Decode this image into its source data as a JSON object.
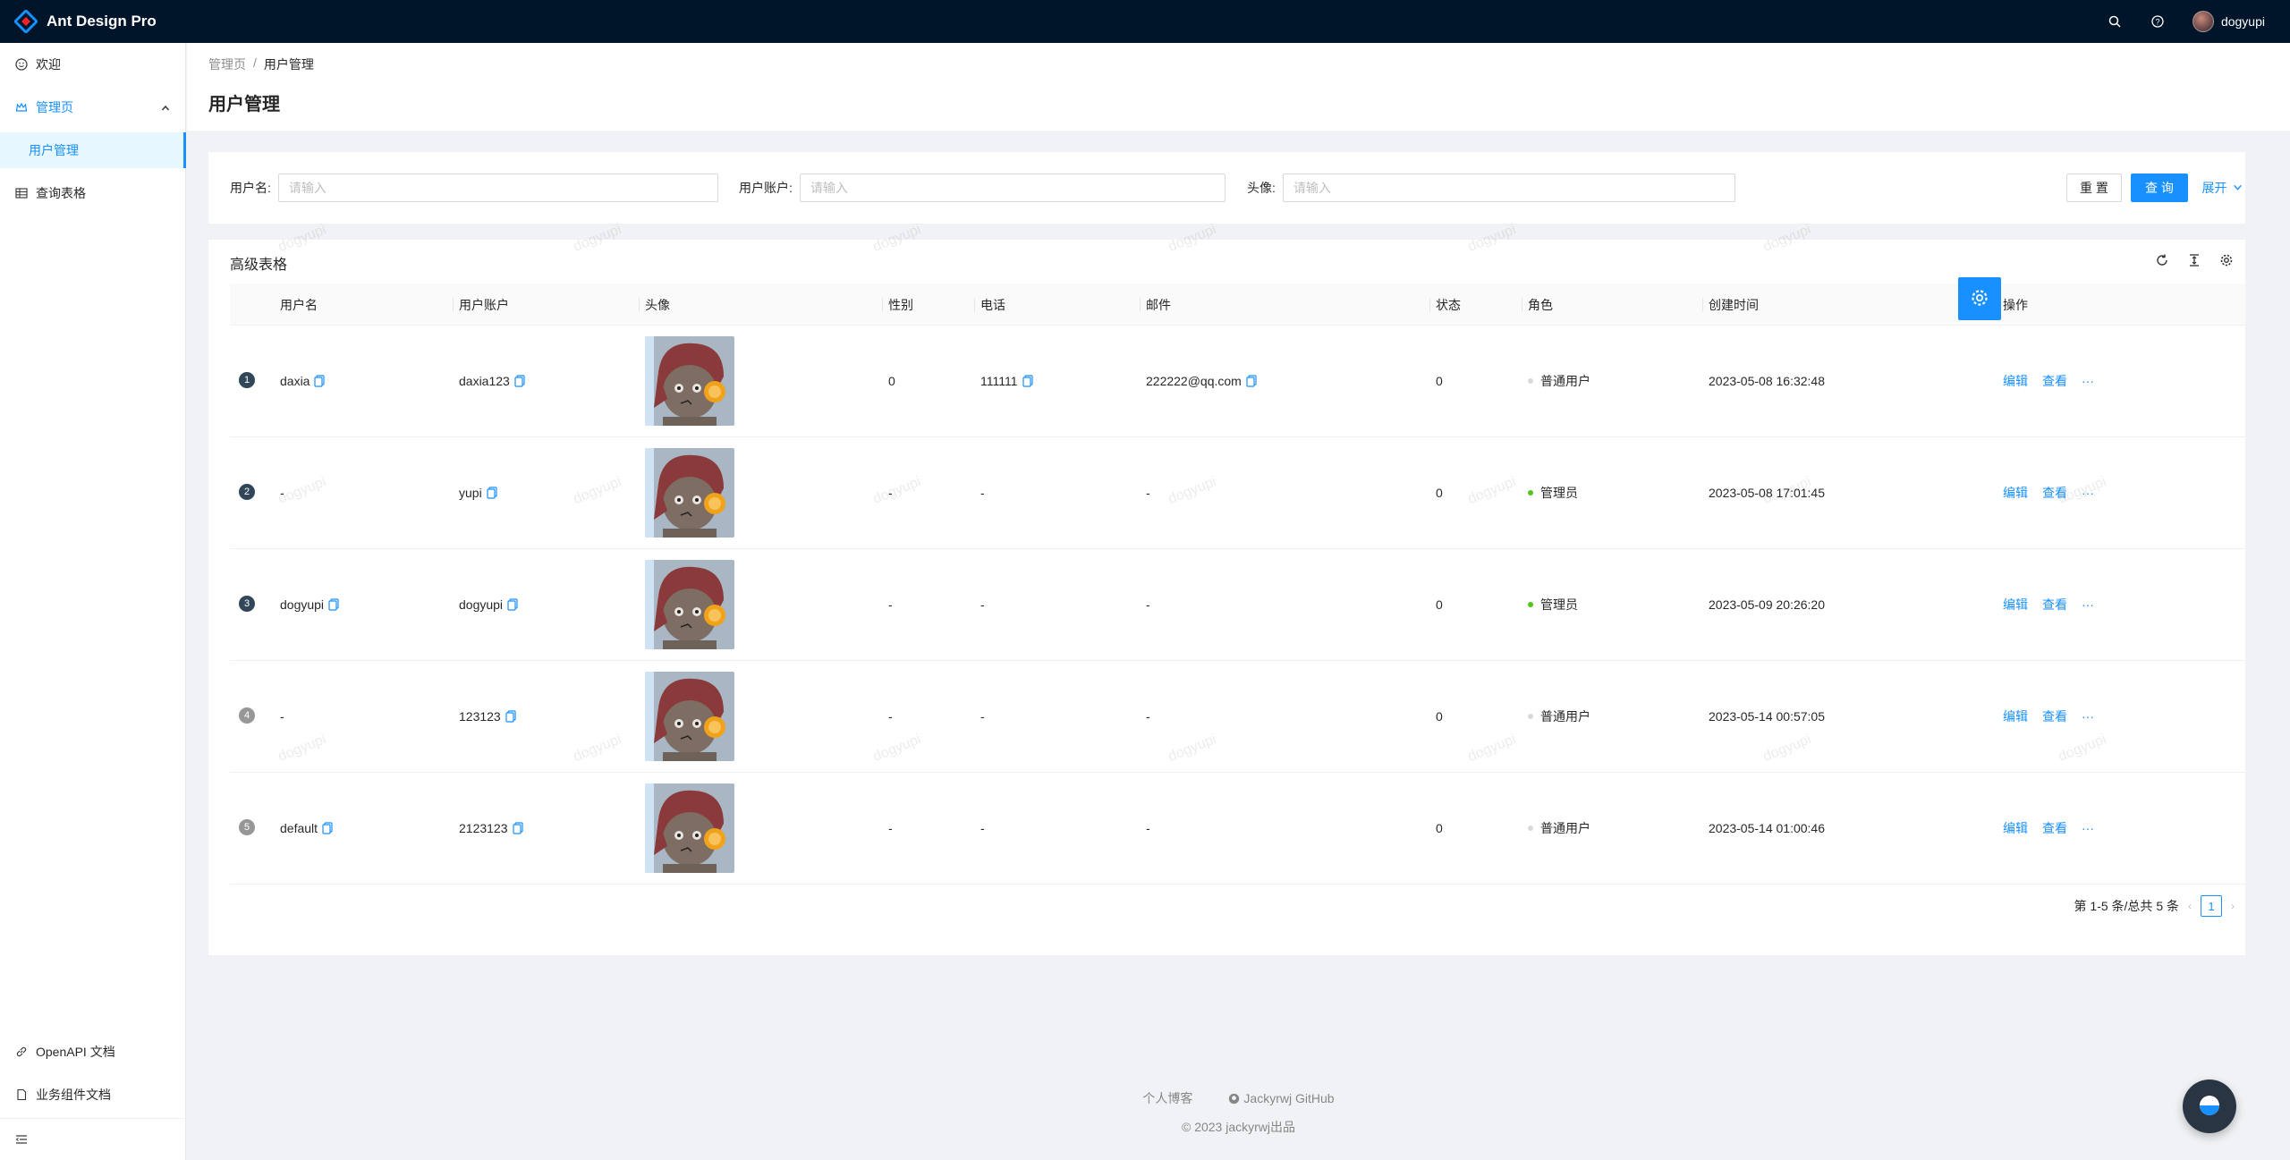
{
  "app": {
    "title": "Ant Design Pro"
  },
  "header": {
    "user_name": "dogyupi",
    "icons": [
      "search-icon",
      "question-icon"
    ]
  },
  "sidebar": {
    "items": [
      {
        "label": "欢迎",
        "icon": "smile-icon"
      },
      {
        "label": "管理页",
        "icon": "crown-icon"
      },
      {
        "label": "用户管理"
      },
      {
        "label": "查询表格",
        "icon": "table-icon"
      }
    ],
    "bottom": [
      {
        "label": "OpenAPI 文档",
        "icon": "link-icon"
      },
      {
        "label": "业务组件文档",
        "icon": "file-icon"
      }
    ]
  },
  "breadcrumb": [
    "管理页",
    "/",
    "用户管理"
  ],
  "page_title": "用户管理",
  "search": {
    "fields": [
      {
        "label": "用户名:",
        "placeholder": "请输入"
      },
      {
        "label": "用户账户:",
        "placeholder": "请输入"
      },
      {
        "label": "头像:",
        "placeholder": "请输入"
      }
    ],
    "reset_label": "重 置",
    "query_label": "查 询",
    "expand_label": "展开"
  },
  "table": {
    "title": "高级表格",
    "columns": [
      "用户名",
      "用户账户",
      "头像",
      "性别",
      "电话",
      "邮件",
      "状态",
      "角色",
      "创建时间",
      "操作"
    ],
    "rows": [
      {
        "index": "1",
        "username": "daxia",
        "account": "daxia123",
        "gender": "0",
        "phone": "111111",
        "email": "222222@qq.com",
        "status": "0",
        "role": "普通用户",
        "created": "2023-05-08 16:32:48"
      },
      {
        "index": "2",
        "username": "-",
        "account": "yupi",
        "gender": "-",
        "phone": "-",
        "email": "-",
        "status": "0",
        "role": "管理员",
        "created": "2023-05-08 17:01:45"
      },
      {
        "index": "3",
        "username": "dogyupi",
        "account": "dogyupi",
        "gender": "-",
        "phone": "-",
        "email": "-",
        "status": "0",
        "role": "管理员",
        "created": "2023-05-09 20:26:20"
      },
      {
        "index": "4",
        "username": "-",
        "account": "123123",
        "gender": "-",
        "phone": "-",
        "email": "-",
        "status": "0",
        "role": "普通用户",
        "created": "2023-05-14 00:57:05"
      },
      {
        "index": "5",
        "username": "default",
        "account": "2123123",
        "gender": "-",
        "phone": "-",
        "email": "-",
        "status": "0",
        "role": "普通用户",
        "created": "2023-05-14 01:00:46"
      }
    ],
    "actions": {
      "edit": "编辑",
      "view": "查看",
      "more": "···"
    },
    "pagination": {
      "summary": "第 1-5 条/总共 5 条",
      "current": "1"
    }
  },
  "watermark": "dogyupi",
  "footer": {
    "link1": "个人博客",
    "link2": "Jackyrwj GitHub",
    "copyright": "© 2023 jackyrwj出品"
  },
  "colors": {
    "primary": "#1890ff",
    "header_bg": "#001529",
    "admin_dot": "#52c41a",
    "user_dot": "#d9d9d9"
  }
}
